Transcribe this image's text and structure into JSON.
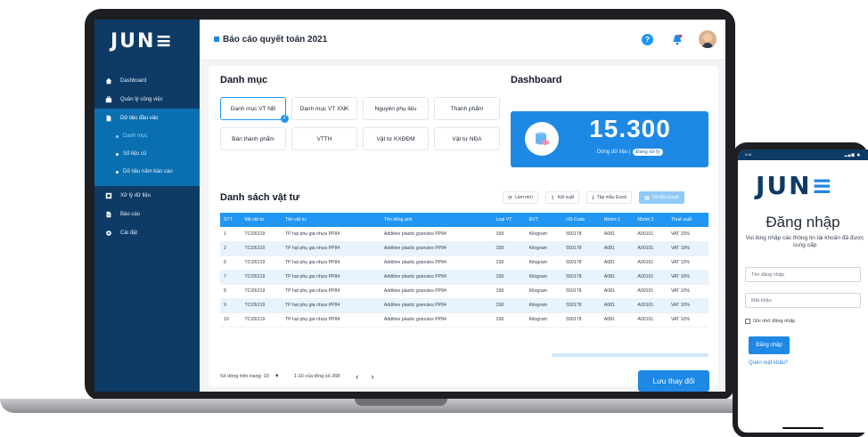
{
  "app": {
    "logo": "JUN",
    "logo_mark": "≡"
  },
  "sidebar": {
    "items": [
      {
        "label": "Dashboard",
        "icon": "home-icon"
      },
      {
        "label": "Quản lý công việc",
        "icon": "briefcase-icon"
      },
      {
        "label": "Dữ liệu đầu vào",
        "icon": "file-icon"
      }
    ],
    "sub_items": [
      {
        "label": "Danh mục"
      },
      {
        "label": "Số liệu cũ"
      },
      {
        "label": "Dữ liệu năm báo cáo"
      }
    ],
    "bottom_items": [
      {
        "label": "Xử lý dữ liệu",
        "icon": "process-icon"
      },
      {
        "label": "Báo cáo",
        "icon": "report-icon"
      },
      {
        "label": "Cài đặt",
        "icon": "gear-icon"
      }
    ]
  },
  "header": {
    "title": "Báo cáo quyết toán 2021",
    "help": "?"
  },
  "categories": {
    "title": "Danh mục",
    "buttons": [
      "Danh mục VT NB",
      "Danh mục VT XNK",
      "Nguyên phụ liệu",
      "Thành phẩm",
      "Bán thành phẩm",
      "VTTH",
      "Vật tư KXĐĐM",
      "Vật tư NĐA"
    ]
  },
  "dashboard": {
    "title": "Dashboard",
    "count": "15.300",
    "label": "Dòng dữ liệu |",
    "badge": "Đang xử lý"
  },
  "materials": {
    "title": "Danh sách vật tư",
    "tools": [
      "Làm mới",
      "Kết xuất",
      "Tập mẫu Excel",
      "Dữ liệu Excel"
    ],
    "columns": [
      "STT",
      "Mã vật tư",
      "Tên vật tư",
      "Tên tiếng anh",
      "Loại VT",
      "ĐVT",
      "HS Code",
      "Nhóm 1",
      "Nhóm 2",
      "Thuế suất"
    ],
    "rows": [
      [
        "1",
        "TCI26219",
        "TP hạt phụ gia nhựa PP84",
        "Additive plastic granules PP84",
        "158",
        "Kilogram",
        "550178",
        "A081",
        "A00101",
        "VAT 10%"
      ],
      [
        "2",
        "TCI26219",
        "TP hạt phụ gia nhựa PP84",
        "Additive plastic granules PP84",
        "158",
        "Kilogram",
        "550178",
        "A081",
        "A00101",
        "VAT 10%"
      ],
      [
        "6",
        "TCI26219",
        "TP hạt phụ gia nhựa PP84",
        "Additive plastic granules PP84",
        "158",
        "Kilogram",
        "550178",
        "A081",
        "A00101",
        "VAT 10%"
      ],
      [
        "7",
        "TCI26219",
        "TP hạt phụ gia nhựa PP84",
        "Additive plastic granules PP84",
        "158",
        "Kilogram",
        "550178",
        "A081",
        "A00101",
        "VAT 10%"
      ],
      [
        "8",
        "TCI26219",
        "TP hạt phụ gia nhựa PP84",
        "Additive plastic granules PP84",
        "158",
        "Kilogram",
        "550178",
        "A081",
        "A00101",
        "VAT 10%"
      ],
      [
        "9",
        "TCI26219",
        "TP hạt phụ gia nhựa PP84",
        "Additive plastic granules PP84",
        "158",
        "Kilogram",
        "550178",
        "A081",
        "A00101",
        "VAT 10%"
      ],
      [
        "10",
        "TCI26219",
        "TP hạt phụ gia nhựa PP84",
        "Additive plastic granules PP84",
        "158",
        "Kilogram",
        "550178",
        "A081",
        "A00101",
        "VAT 10%"
      ]
    ],
    "pager_rows": "Số dòng trên trang: 10",
    "pager_range": "1-10 của tổng số 268",
    "save_label": "Lưu thay đổi"
  },
  "phone": {
    "time": "9:41",
    "title": "Đăng nhập",
    "subtitle": "Vui lòng nhập các thông tin tài khoản đã được cung cấp",
    "username_placeholder": "Tên đăng nhập",
    "password_placeholder": "Mật khẩu",
    "remember": "Ghi nhớ đăng nhập",
    "login": "Đăng nhập",
    "forgot": "Quên mật khẩu?"
  },
  "colors": {
    "sidebar": "#0d3b66",
    "accent": "#1e88e5",
    "active_nav": "#0a6fb0"
  }
}
